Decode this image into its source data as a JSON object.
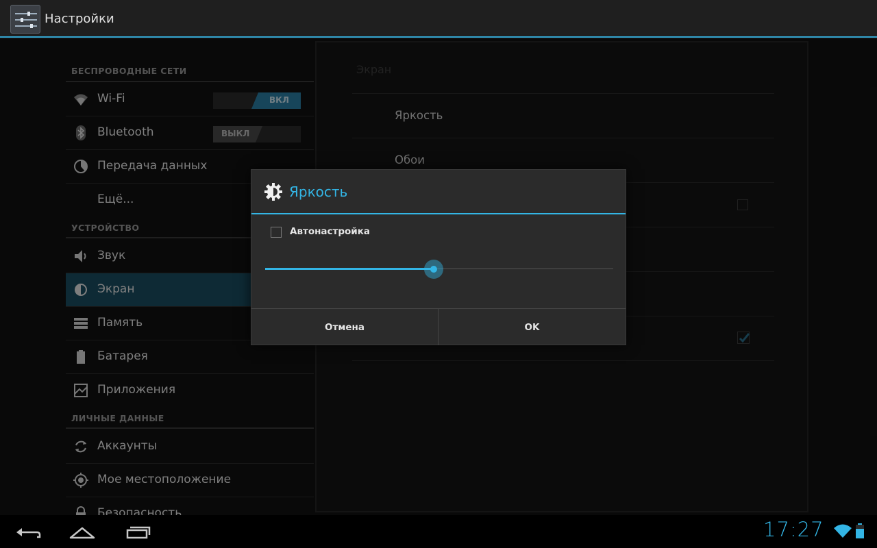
{
  "actionbar": {
    "title": "Настройки",
    "icon": "settings-sliders-icon"
  },
  "sidebar": {
    "categories": [
      {
        "label": "БЕСПРОВОДНЫЕ СЕТИ"
      },
      {
        "label": "УСТРОЙСТВО"
      },
      {
        "label": "ЛИЧНЫЕ ДАННЫЕ"
      }
    ],
    "items": [
      {
        "label": "Wi-Fi",
        "icon": "wifi-icon",
        "toggle": "ВКЛ"
      },
      {
        "label": "Bluetooth",
        "icon": "bluetooth-icon",
        "toggle": "ВЫКЛ"
      },
      {
        "label": "Передача данных",
        "icon": "data-usage-icon"
      },
      {
        "label": "Ещё..."
      },
      {
        "label": "Звук",
        "icon": "speaker-icon"
      },
      {
        "label": "Экран",
        "icon": "brightness-icon",
        "selected": true
      },
      {
        "label": "Память",
        "icon": "storage-icon"
      },
      {
        "label": "Батарея",
        "icon": "battery-icon"
      },
      {
        "label": "Приложения",
        "icon": "apps-icon"
      },
      {
        "label": "Аккаунты",
        "icon": "sync-icon"
      },
      {
        "label": "Мое местоположение",
        "icon": "location-icon"
      },
      {
        "label": "Безопасность",
        "icon": "lock-icon"
      }
    ]
  },
  "detail": {
    "section": "Экран",
    "rows": [
      {
        "label": "Яркость"
      },
      {
        "label": "Обои"
      }
    ]
  },
  "dialog": {
    "title": "Яркость",
    "auto_label": "Автонастройка",
    "auto_checked": false,
    "brightness_fraction": 0.485,
    "cancel_label": "Отмена",
    "ok_label": "OK"
  },
  "statusbar": {
    "time": "17:27"
  },
  "colors": {
    "accent": "#33b5e5",
    "selected_bg": "#1a4d61"
  }
}
